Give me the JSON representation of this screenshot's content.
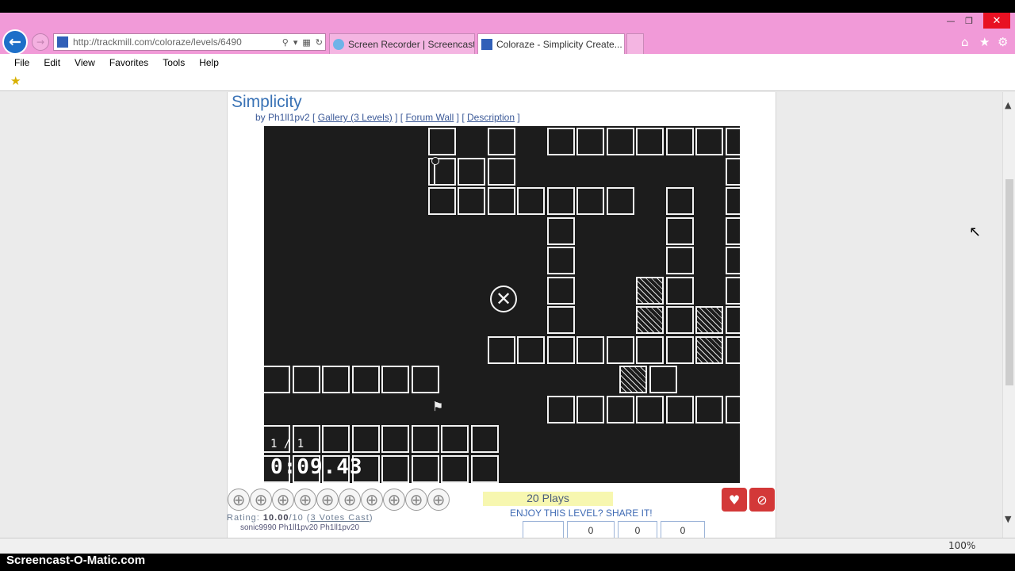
{
  "browser": {
    "address": "http://trackmill.com/coloraze/levels/6490",
    "tabs": [
      {
        "label": "Screen Recorder | Screencast-..."
      },
      {
        "label": "Coloraze - Simplicity Create..."
      }
    ],
    "menu": [
      "File",
      "Edit",
      "View",
      "Favorites",
      "Tools",
      "Help"
    ],
    "zoom": "100%"
  },
  "level": {
    "title": "Simplicity",
    "by_prefix": "by Ph1ll1pv2 [",
    "gallery_link": "Gallery (3 Levels)",
    "forum_link": "Forum Wall",
    "description_link": "Description"
  },
  "game": {
    "counter": "1 / 1",
    "timer": "0:09.43"
  },
  "stats": {
    "rating_label": "Rating:",
    "rating_value": "10.00",
    "rating_out_of": "/10 (",
    "votes_link": "3 Votes Cast",
    "plays": "20 Plays",
    "share_text": "ENJOY THIS LEVEL? SHARE IT!",
    "thumbs": "sonic9990  Ph1ll1pv20  Ph1ll1pv20",
    "share_counts": [
      "0",
      "0",
      "0"
    ]
  },
  "watermark": "Screencast-O-Matic.com"
}
